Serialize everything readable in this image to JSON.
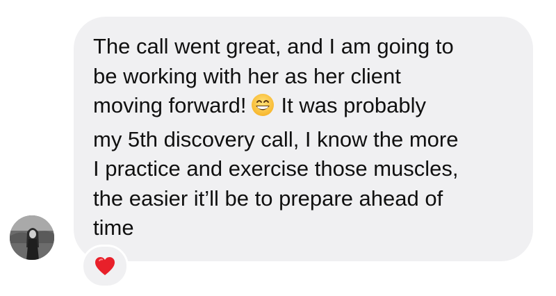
{
  "conversation": {
    "message": {
      "lines": [
        "The call went great, and I am going to",
        "be working with her as her client",
        "moving forward!",
        "It was probably",
        "my 5th discovery call, I know the more",
        "I practice and exercise those muscles,",
        "the easier it’ll be to prepare ahead of",
        "time"
      ],
      "inline_emoji": "grinning-face-with-smiling-eyes-icon",
      "bubble_color": "#f0f0f2",
      "text_color": "#101010"
    },
    "reaction": {
      "icon": "red-heart-icon",
      "color": "#e8202a"
    },
    "sender": {
      "avatar": "sender-avatar"
    }
  }
}
